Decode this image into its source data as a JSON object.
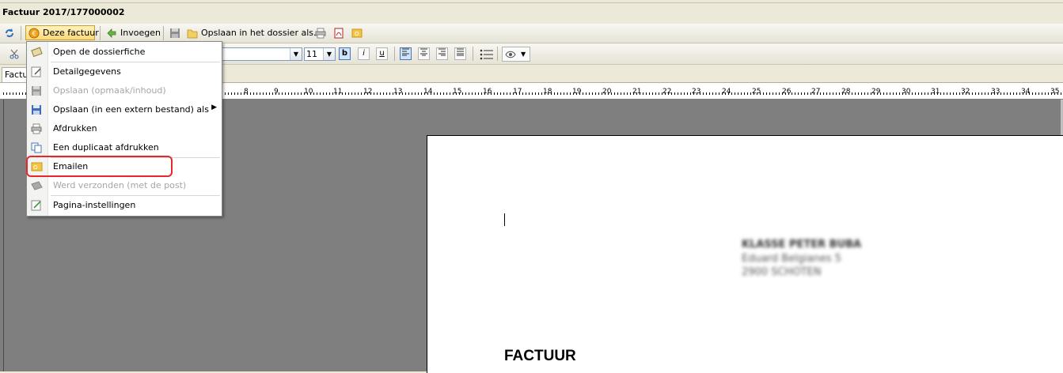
{
  "window": {
    "title": "Factuur 2017/177000002"
  },
  "toolbar": {
    "refresh_icon": "refresh-icon",
    "this_invoice_label": "Deze factuur",
    "insert_label": "Invoegen",
    "save_in_file_label": "Opslaan in het dossier als..."
  },
  "format_bar": {
    "font_size": "11",
    "bold": "b",
    "italic": "i",
    "underline": "u"
  },
  "tabs": [
    "Factu"
  ],
  "ruler": {
    "numbers": [
      "8",
      "9",
      "10",
      "11",
      "12",
      "13",
      "14",
      "15",
      "16",
      "17",
      "18",
      "19",
      "20",
      "21",
      "22",
      "23",
      "24",
      "25",
      "26",
      "27",
      "28",
      "29",
      "30",
      "31",
      "32",
      "33",
      "34",
      "35"
    ]
  },
  "menu": {
    "items": [
      {
        "label": "Open de dossierfiche",
        "icon": "folder-card-icon",
        "enabled": true
      },
      {
        "label": "Detailgegevens",
        "icon": "details-edit-icon",
        "enabled": true
      },
      {
        "label": "Opslaan (opmaak/inhoud)",
        "icon": "save-icon",
        "enabled": false
      },
      {
        "label": "Opslaan (in een extern bestand) als",
        "icon": "save-as-icon",
        "enabled": true,
        "submenu": true
      },
      {
        "label": "Afdrukken",
        "icon": "printer-icon",
        "enabled": true
      },
      {
        "label": "Een duplicaat afdrukken",
        "icon": "duplicate-icon",
        "enabled": true
      },
      {
        "label": "Emailen",
        "icon": "email-icon",
        "enabled": true,
        "highlighted": true
      },
      {
        "label": "Werd verzonden (met de post)",
        "icon": "mail-sent-icon",
        "enabled": false
      },
      {
        "label": "Pagina-instellingen",
        "icon": "page-setup-icon",
        "enabled": true
      }
    ]
  },
  "document": {
    "address_lines": [
      "KLASSE PETER BUBA",
      "Eduard Belgianes 5",
      "2900 SCHOTEN"
    ],
    "heading": "FACTUUR"
  },
  "colors": {
    "accent_highlight": "#e8262c",
    "active_button": "#fcd977",
    "workspace": "#7f7f7f"
  }
}
